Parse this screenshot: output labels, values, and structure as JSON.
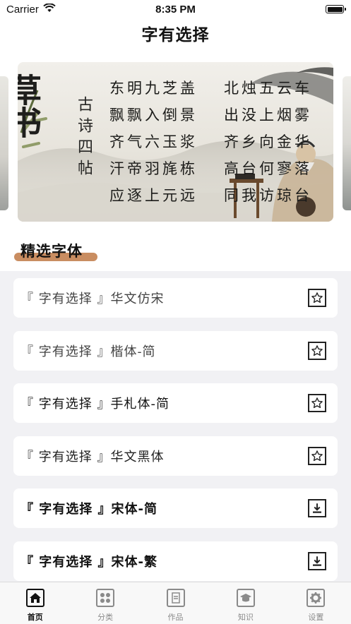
{
  "status_bar": {
    "carrier": "Carrier",
    "time": "8:35 PM"
  },
  "nav": {
    "title": "字有选择"
  },
  "banner": {
    "title_chars": "草书",
    "subtitle": "古诗四帖",
    "poem_left": [
      "东明九芝盖",
      "飘飘入倒景",
      "齐气六玉浆",
      "汗帝羽旄栋",
      "应逐上元远"
    ],
    "poem_right": [
      "北烛五云车",
      "出没上烟雾",
      "齐乡向金华",
      "高台何寥落",
      "同我访琼台"
    ]
  },
  "section": {
    "title": "精选字体"
  },
  "fonts": [
    {
      "name": "『 字有选择 』华文仿宋",
      "action": "star-icon"
    },
    {
      "name": "『 字有选择 』楷体-简",
      "action": "star-icon"
    },
    {
      "name": "『 字有选择 』手札体-简",
      "action": "star-icon"
    },
    {
      "name": "『 字有选择 』华文黑体",
      "action": "star-icon"
    },
    {
      "name": "『 字有选择 』宋体-简",
      "action": "download-icon"
    },
    {
      "name": "『 字有选择 』宋体-繁",
      "action": "download-icon"
    }
  ],
  "tabs": [
    {
      "label": "首页",
      "icon": "home-icon",
      "active": true
    },
    {
      "label": "分类",
      "icon": "grid-icon",
      "active": false
    },
    {
      "label": "作品",
      "icon": "document-icon",
      "active": false
    },
    {
      "label": "知识",
      "icon": "graduation-cap-icon",
      "active": false
    },
    {
      "label": "设置",
      "icon": "gear-icon",
      "active": false
    }
  ],
  "colors": {
    "accent": "#c98d61",
    "list_background": "#f1f1f4",
    "active_tab": "#111111",
    "inactive_tab": "#8a8a8a"
  }
}
